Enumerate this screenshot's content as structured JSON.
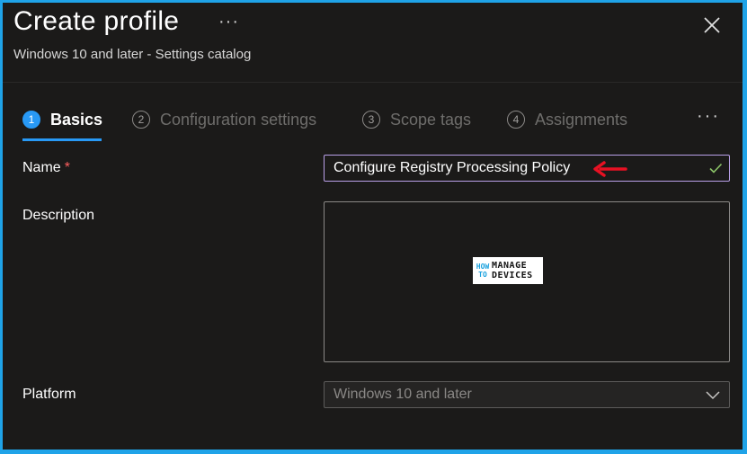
{
  "header": {
    "title": "Create profile",
    "subtitle": "Windows 10 and later - Settings catalog",
    "more_label": "···",
    "close_icon": "close-icon"
  },
  "steps": [
    {
      "num": "1",
      "label": "Basics",
      "active": true
    },
    {
      "num": "2",
      "label": "Configuration settings",
      "active": false
    },
    {
      "num": "3",
      "label": "Scope tags",
      "active": false
    },
    {
      "num": "4",
      "label": "Assignments",
      "active": false
    }
  ],
  "steps_more_label": "···",
  "form": {
    "name_label": "Name",
    "required_mark": "*",
    "name_value": "Configure Registry Processing Policy",
    "description_label": "Description",
    "description_value": "",
    "platform_label": "Platform",
    "platform_value": "Windows 10 and later"
  },
  "watermark": {
    "how": "HOW",
    "to": "TO",
    "manage": "MANAGE",
    "devices": "DEVICES"
  },
  "colors": {
    "accent": "#2899f5",
    "required": "#ff5f5f",
    "valid_check": "#8cc468",
    "annotation_arrow": "#e81123",
    "frame_border": "#1fa3e8"
  }
}
